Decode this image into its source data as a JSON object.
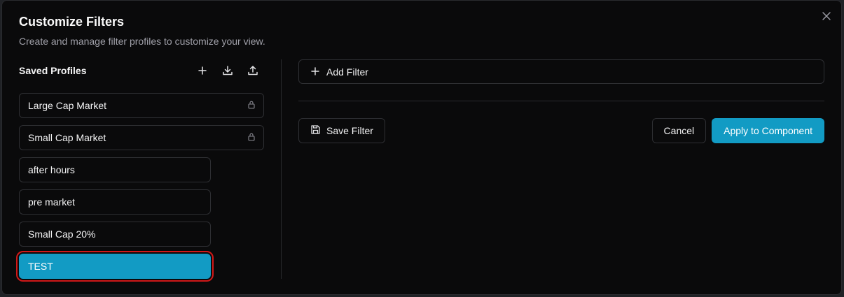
{
  "dialog": {
    "title": "Customize Filters",
    "subtitle": "Create and manage filter profiles to customize your view."
  },
  "sidebar": {
    "heading": "Saved Profiles",
    "profiles": [
      {
        "label": "Large Cap Market",
        "locked": true
      },
      {
        "label": "Small Cap Market",
        "locked": true
      },
      {
        "label": "after hours",
        "locked": false
      },
      {
        "label": "pre market",
        "locked": false
      },
      {
        "label": "Small Cap 20%",
        "locked": false
      },
      {
        "label": "TEST",
        "locked": false,
        "selected": true
      }
    ]
  },
  "main": {
    "add_filter_label": "Add Filter",
    "save_filter_label": "Save Filter",
    "cancel_label": "Cancel",
    "apply_label": "Apply to Component"
  },
  "colors": {
    "accent": "#129bc4",
    "selection_outline": "#d01818",
    "background": "#0a0a0b"
  }
}
